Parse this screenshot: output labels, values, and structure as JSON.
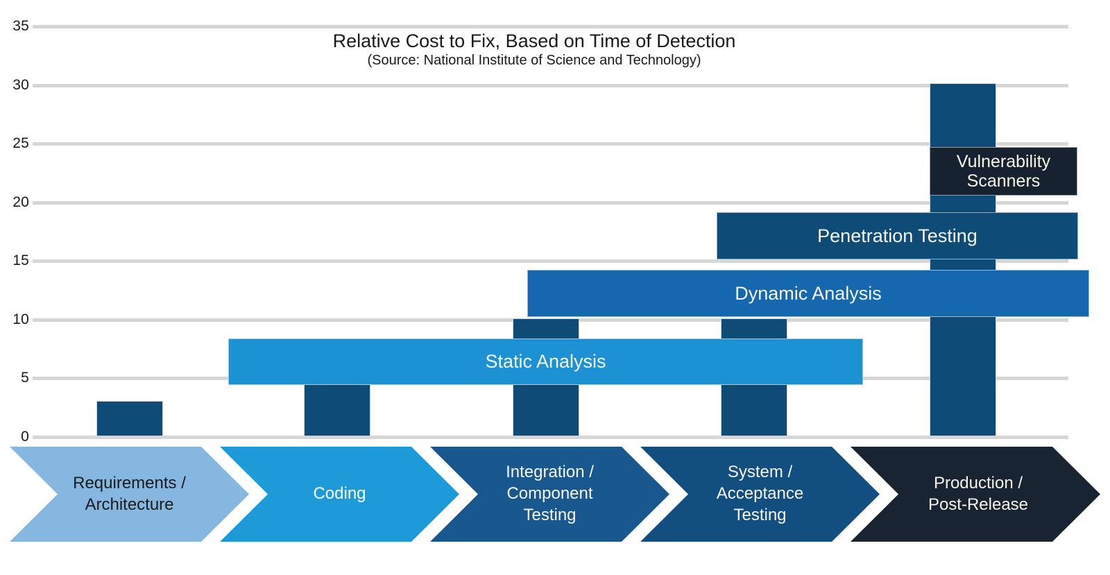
{
  "chart_data": {
    "type": "bar",
    "title": "Relative Cost to Fix, Based on Time of Detection",
    "subtitle": "(Source: National Institute of Science and Technology)",
    "xlabel": "",
    "ylabel": "",
    "ylim": [
      0,
      35
    ],
    "grid": true,
    "legend_position": "none",
    "y_ticks": [
      "35",
      "30",
      "25",
      "20",
      "15",
      "10",
      "5",
      "0"
    ],
    "y_tick_values": [
      35,
      30,
      25,
      20,
      15,
      10,
      5,
      0
    ],
    "categories": [
      "Requirements / Architecture",
      "Coding",
      "Integration / Component Testing",
      "System / Acceptance Testing",
      "Production / Post-Release"
    ],
    "values": [
      2,
      5,
      10,
      10,
      30
    ],
    "series": [
      {
        "name": "Relative Cost to Fix",
        "values": [
          2,
          5,
          10,
          10,
          30
        ],
        "color": "#0e4c77"
      }
    ],
    "annotation_bands": [
      {
        "label": "Static Analysis",
        "color": "#1c91d4",
        "y_top": 8.2,
        "y_bottom": 4.3,
        "start_category_index": 1,
        "end_category_index": 3
      },
      {
        "label": "Dynamic Analysis",
        "color": "#1668ae",
        "y_top": 14,
        "y_bottom": 10,
        "start_category_index": 2,
        "end_category_index": 4
      },
      {
        "label": "Penetration Testing",
        "color": "#0e4c77",
        "y_top": 19,
        "y_bottom": 15,
        "start_category_index": 3,
        "end_category_index": 4
      },
      {
        "label": "Vulnerability\nScanners",
        "color": "#16222f",
        "y_top": 24.5,
        "y_bottom": 20.5,
        "start_category_index": 4,
        "end_category_index": 4
      }
    ]
  },
  "title": {
    "main": "Relative Cost to Fix, Based on Time of Detection",
    "source": "(Source: National Institute of Science and Technology)"
  },
  "axis": {
    "y_ticks": [
      "35",
      "30",
      "25",
      "20",
      "15",
      "10",
      "5",
      "0"
    ]
  },
  "bands": {
    "static_analysis": "Static Analysis",
    "dynamic_analysis": "Dynamic Analysis",
    "penetration_testing": "Penetration Testing",
    "vulnerability_scanners": "Vulnerability\nScanners"
  },
  "phases": [
    {
      "label": "Requirements /\nArchitecture",
      "fill": "#85b7e0",
      "text": "#1b1b1b"
    },
    {
      "label": "Coding",
      "fill": "#1c9bd8",
      "text": "#ffffff"
    },
    {
      "label": "Integration /\nComponent\nTesting",
      "fill": "#19588f",
      "text": "#f7f5ea"
    },
    {
      "label": "System /\nAcceptance\nTesting",
      "fill": "#124e80",
      "text": "#f7f5ea"
    },
    {
      "label": "Production /\nPost-Release",
      "fill": "#192432",
      "text": "#f7f5ea"
    }
  ],
  "colors": {
    "bar": "#0e4c77",
    "gridline": "#d4d6d8",
    "background": "#ffffff",
    "static_analysis": "#1c91d4",
    "dynamic_analysis": "#1668ae",
    "penetration_testing": "#0e4c77",
    "vulnerability_scanners": "#16222f"
  }
}
